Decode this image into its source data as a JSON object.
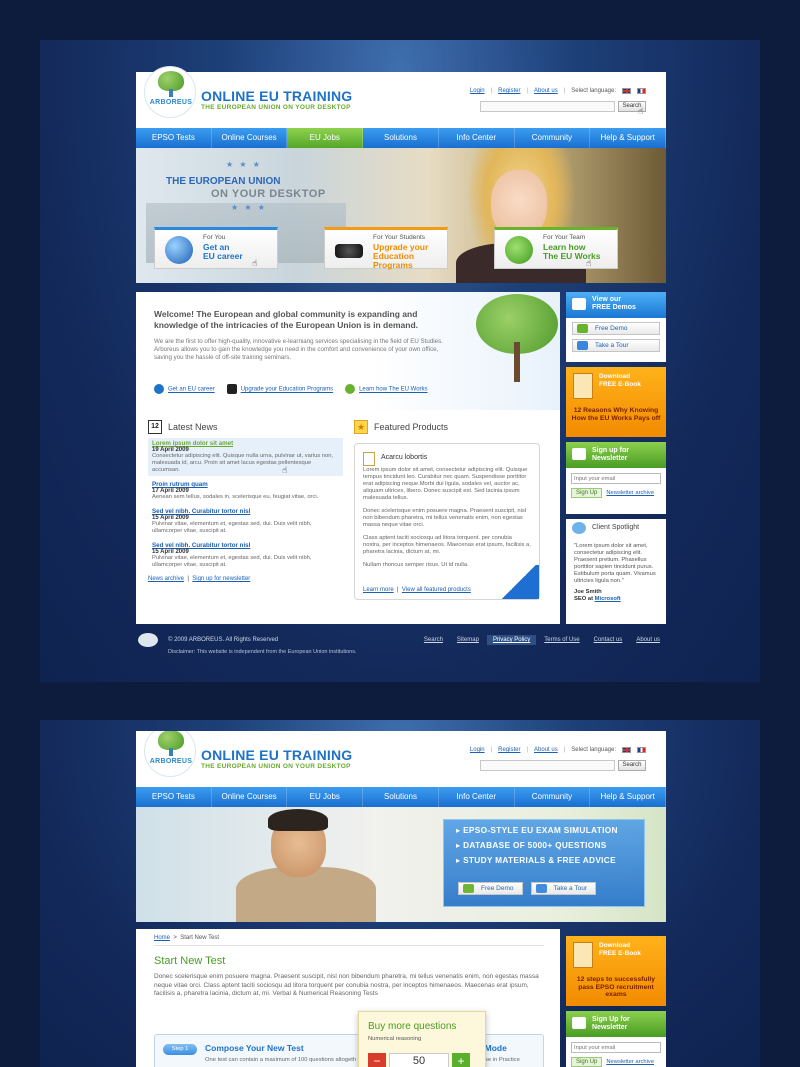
{
  "site": {
    "logo_word": "ARBOREUS",
    "brand": "ONLINE EU TRAINING",
    "tagline": "THE EUROPEAN UNION ON YOUR DESKTOP",
    "top_links": [
      "Login",
      "Register",
      "About us"
    ],
    "language_label": "Select language:",
    "search_button": "Search"
  },
  "nav": [
    "EPSO Tests",
    "Online Courses",
    "EU Jobs",
    "Solutions",
    "Info Center",
    "Community",
    "Help & Support"
  ],
  "page1": {
    "hero": {
      "line1": "THE EUROPEAN UNION",
      "line2": "ON YOUR DESKTOP",
      "promos": [
        {
          "label": "For You",
          "title_1": "Get an",
          "title_2": "EU career"
        },
        {
          "label": "For Your Students",
          "title_1": "Upgrade your",
          "title_2": "Education Programs"
        },
        {
          "label": "For Your Team",
          "title_1": "Learn how",
          "title_2": "The EU Works"
        }
      ]
    },
    "welcome": {
      "heading": "Welcome! The European and global community is expanding and knowledge of the intricacies of the European Union is in demand.",
      "body": "We are the first to offer high-quality, innovative e-learniang services specialising in the field of EU Studies. Arboreus allows you to gain the knowledge you need in the comfort and convenience of your own office, saving you the hassle of off-site training seminars.",
      "links": [
        "Get an EU career",
        "Upgrade your Education Programs",
        "Learn how The EU Works"
      ]
    },
    "news": {
      "title": "Latest News",
      "calendar_day": "12",
      "items": [
        {
          "title": "Lorem ipsum dolor sit amet",
          "date": "19 April 2009",
          "text": "Consectetur adipiscing elit. Quisque nulla urna, pulvinar ut, varius non, malesuada id, arcu. Proin sit amet lacus egestas pellentesque accumsan."
        },
        {
          "title": "Proin rutrum quam",
          "date": "17 April 2009",
          "text": "Aenean sem tellus, sodales in, scelerisque eu, feugiat vitae, orci."
        },
        {
          "title": "Sed vel nibh. Curabitur tortor nisl",
          "date": "15 April 2009",
          "text": "Pulvinar vitae, elementum et, egestas sed, dui. Duis velit nibh, ullamcorper vitae, suscipit at."
        },
        {
          "title": "Sed vel nibh. Curabitur tortor nisl",
          "date": "15 April 2009",
          "text": "Pulvinar vitae, elementum et, egestas sed, dui. Duis velit nibh, ullamcorper vitae, suscipit at."
        }
      ],
      "archive_link": "News archive",
      "signup_link": "Sign up for newsletter"
    },
    "featured": {
      "title": "Featured Products",
      "product": "Acarcu lobortis",
      "p1": "Lorem ipsum dolor sit amet, consectetur adipiscing elit. Quisque tempus tincidunt leo. Curabitur nec quam. Suspendisse porttitor erat adipiscing neque.Morbi dui ligula, sodales vel, auctor ac, aliquam ultrices, libero. Donec suscipit est. Sed lacinia ipsum malesuada tellus.",
      "p2": "Donec scelerisque enim posuere magna. Praesent suscipit, nisl non bibendum pharetra, mi tellus venenatis enim, non egestas massa neque vitae orci.",
      "p3": "Class aptent taciti sociosqu ad litora torquent. per conubia nostra, per inceptos himenaeos. Maecenas erat ipsum, facilisis a, pharetra lacinia, dictum at, mi.",
      "p4": "Nullam rhoncus semper risus. Ut id nulla.",
      "learn_more": "Learn more",
      "view_all": "View all featured products"
    },
    "sidebar": {
      "demo_title_1": "View our",
      "demo_title_2": "FREE Demos",
      "free_demo": "Free Demo",
      "take_tour": "Take a Tour",
      "ebook_h1": "Download",
      "ebook_h2": "FREE E-Book",
      "ebook_desc": "12 Reasons Why Knowing How the EU Works Pays off",
      "newsletter_1": "Sign up for",
      "newsletter_2": "Newsletter",
      "email_placeholder": "Input your email",
      "signup_btn": "Sign Up",
      "newsletter_archive": "Newsletter archive",
      "client_title": "Client Spotlight",
      "client_quote": "\"Lorem ipsum dolor sit amet, consectetur adipiscing elit. Praesent pretium. Phasellus porttitor sapien tincidunt purus. Estibulum porta quam. Vivamus ultricies ligula non.\"",
      "client_name": "Joe Smith",
      "client_role": "SEO at",
      "client_company": "Microsoft"
    },
    "footer": {
      "copyright": "© 2009 ARBOREUS. All Rights Reserved",
      "disclaimer": "Disclaimer: This website is independent from the European Union institutions.",
      "links": [
        "Search",
        "Sitemap",
        "Privacy Policy",
        "Terms of Use",
        "Contact us",
        "About us"
      ]
    }
  },
  "page2": {
    "hero_lines": [
      "EPSO-STYLE EU EXAM SIMULATION",
      "DATABASE OF 5000+ QUESTIONS",
      "STUDY MATERIALS & FREE ADVICE"
    ],
    "free_demo": "Free Demo",
    "take_tour": "Take a Tour",
    "breadcrumb_home": "Home",
    "breadcrumb_current": "Start New Test",
    "heading": "Start New Test",
    "intro": "Donec scelerisque enim posuere magna. Praesent suscipit, nisl non bibendum pharetra, mi tellus venenatis enim, non egestas massa neque vitae orci. Class aptent taciti sociosqu ad litora torquent per conubia nostra, per inceptos himenaeos. Maecenas erat ipsum, facilisis a, pharetra lacinia, dictum at, mi. Verbal & Numerical Reasoning Tests",
    "step_label": "Step 1",
    "compose_title": "Compose Your New Test",
    "compose_desc": "One test can contain a maximum of 100 questions altogeth",
    "right_title": "est Mode",
    "right_desc": "se in Practice",
    "popup_title": "Buy more questions",
    "popup_sub": "Numerical reasoning",
    "popup_value": "50",
    "ebook_desc": "12 steps to successfully pass EPSO recruitment exams",
    "signup_1": "Sign Up for",
    "signup_2": "Newsletter"
  }
}
